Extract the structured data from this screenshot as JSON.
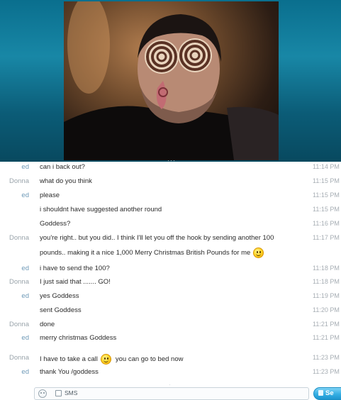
{
  "messages": [
    {
      "sender": "ed",
      "text": "can i back out?",
      "time": "11:14 PM"
    },
    {
      "sender": "Donna",
      "text": "what do you think",
      "time": "11:15 PM"
    },
    {
      "sender": "ed",
      "text": "please",
      "time": "11:15 PM"
    },
    {
      "sender": "",
      "text": "i shouldnt have suggested another round",
      "time": "11:15 PM"
    },
    {
      "sender": "",
      "text": "Goddess?",
      "time": "11:16 PM"
    },
    {
      "sender": "Donna",
      "text": "you're right.. but you did..   I think I'll let you off the hook by sending another 100",
      "time": "11:17 PM"
    },
    {
      "sender": "",
      "text": "pounds.. making it a nice 1,000 Merry Christmas British Pounds for me",
      "time": "",
      "emoticon": "smile-emoticon"
    },
    {
      "sender": "ed",
      "text": "i have to send the 100?",
      "time": "11:18 PM"
    },
    {
      "sender": "Donna",
      "text": "I just said that ....... GO!",
      "time": "11:18 PM"
    },
    {
      "sender": "ed",
      "text": "yes Goddess",
      "time": "11:19 PM"
    },
    {
      "sender": "",
      "text": "sent Goddess",
      "time": "11:20 PM"
    },
    {
      "sender": "Donna",
      "text": "done",
      "time": "11:21 PM"
    },
    {
      "sender": "ed",
      "text": "merry christmas Goddess",
      "time": "11:21 PM"
    },
    {
      "sender": "Donna",
      "text_before": "I have to take a call",
      "text_after": "you can go to bed now",
      "time": "11:23 PM",
      "emoticon": "smile-emoticon"
    },
    {
      "sender": "ed",
      "text": "thank You /goddess",
      "time": "11:23 PM"
    }
  ],
  "compose": {
    "sms_label": "SMS",
    "send_label": "Se"
  },
  "colors": {
    "sender_ed": "#6f9ab8",
    "sender_donna": "#9aa4ab",
    "send_button": "#34aee3",
    "video_background": "#0a6f8e"
  },
  "icons": {
    "emoticon_picker": "smiley-outline-icon",
    "send": "send-icon"
  }
}
